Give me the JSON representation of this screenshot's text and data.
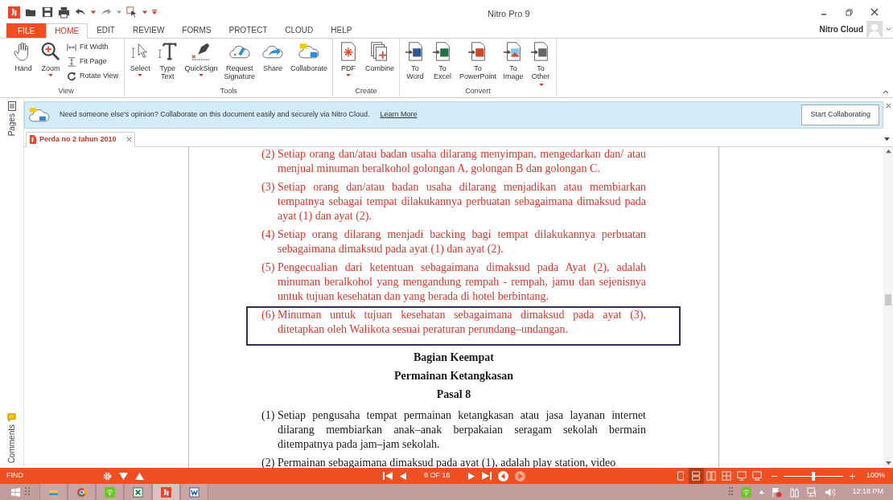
{
  "window": {
    "title": "Nitro Pro 9"
  },
  "ribbon_tabs": [
    {
      "label": "FILE",
      "kind": "file",
      "selected": false
    },
    {
      "label": "HOME",
      "kind": "tab",
      "selected": true
    },
    {
      "label": "EDIT",
      "kind": "tab",
      "selected": false
    },
    {
      "label": "REVIEW",
      "kind": "tab",
      "selected": false
    },
    {
      "label": "FORMS",
      "kind": "tab",
      "selected": false
    },
    {
      "label": "PROTECT",
      "kind": "tab",
      "selected": false
    },
    {
      "label": "CLOUD",
      "kind": "tab",
      "selected": false
    },
    {
      "label": "HELP",
      "kind": "tab",
      "selected": false
    }
  ],
  "account": {
    "label": "Nitro Cloud"
  },
  "ribbon_groups": [
    {
      "label": "View",
      "items": [
        {
          "kind": "large",
          "label": "Hand",
          "dropdown": false
        },
        {
          "kind": "large",
          "label": "Zoom",
          "dropdown": true
        },
        {
          "kind": "small",
          "label": "Fit Width"
        },
        {
          "kind": "small",
          "label": "Fit Page"
        },
        {
          "kind": "small",
          "label": "Rotate View"
        }
      ]
    },
    {
      "label": "Tools",
      "items": [
        {
          "kind": "large",
          "label": "Select",
          "dropdown": true
        },
        {
          "kind": "large",
          "label": "Type Text",
          "dropdown": false
        },
        {
          "kind": "large",
          "label": "QuickSign",
          "dropdown": true
        },
        {
          "kind": "large",
          "label": "Request Signature",
          "dropdown": false
        },
        {
          "kind": "large",
          "label": "Share",
          "dropdown": false
        },
        {
          "kind": "large",
          "label": "Collaborate",
          "dropdown": false
        }
      ]
    },
    {
      "label": "Create",
      "items": [
        {
          "kind": "large",
          "label": "PDF",
          "dropdown": true
        },
        {
          "kind": "large",
          "label": "Combine",
          "dropdown": false
        }
      ]
    },
    {
      "label": "Convert",
      "items": [
        {
          "kind": "large",
          "label": "To Word",
          "dropdown": false
        },
        {
          "kind": "large",
          "label": "To Excel",
          "dropdown": false
        },
        {
          "kind": "large",
          "label": "To PowerPoint",
          "dropdown": false
        },
        {
          "kind": "large",
          "label": "To Image",
          "dropdown": false
        },
        {
          "kind": "menu",
          "label": "To Other",
          "dropdown": true
        }
      ]
    }
  ],
  "side_panels": [
    {
      "label": "Pages"
    },
    {
      "label": "Comments"
    }
  ],
  "banner": {
    "message": "Need someone else's opinion? Collaborate on this document easily and securely via Nitro Cloud.",
    "link": "Learn More",
    "button": "Start Collaborating"
  },
  "doc_tabs": [
    {
      "label": "Perda no 2 tahun 2010",
      "selected": true
    }
  ],
  "document": {
    "blocks": [
      {
        "kind": "item",
        "number": "(2)",
        "text": "Setiap orang dan/atau badan usaha dilarang menyimpan, mengedarkan dan/ atau menjual minuman beralkohol golongan A, golongan B dan golongan C.",
        "color": "#e4332b",
        "boxed": false
      },
      {
        "kind": "item",
        "number": "(3)",
        "text": "Setiap orang dan/atau badan usaha dilarang menjadikan atau membiarkan tempatnya sebagai tempat dilakukannya perbuatan sebagaimana dimaksud pada ayat (1) dan ayat (2).",
        "color": "#e4332b",
        "boxed": false
      },
      {
        "kind": "item",
        "number": "(4)",
        "text": "Setiap orang dilarang menjadi backing bagi tempat dilakukannya perbuatan sebagaimana  dimaksud pada ayat (1) dan ayat (2).",
        "color": "#e4332b",
        "boxed": false
      },
      {
        "kind": "item",
        "number": "(5)",
        "text": "Pengecualian dari ketentuan sebagaimana dimaksud pada Ayat (2), adalah minuman beralkohol yang mengandung rempah - rempah, jamu dan sejenisnya untuk tujuan kesehatan dan yang berada di hotel berbintang.",
        "color": "#e4332b",
        "boxed": false
      },
      {
        "kind": "item",
        "number": "(6)",
        "text": "Minuman untuk tujuan kesehatan sebagaimana dimaksud pada ayat (3), ditetapkan oleh Walikota sesuai peraturan perundang–undangan.",
        "color": "#e4332b",
        "boxed": true
      },
      {
        "kind": "heading",
        "text": "Bagian Keempat"
      },
      {
        "kind": "heading",
        "text": "Permainan Ketangkasan"
      },
      {
        "kind": "heading",
        "text": "Pasal 8"
      },
      {
        "kind": "item",
        "number": "(1)",
        "text": "Setiap pengusaha tempat permainan ketangkasan atau jasa layanan internet dilarang membiarkan anak–anak berpakaian seragam sekolah bermain ditempatnya pada jam–jam sekolah.",
        "color": "#1a1a1a",
        "boxed": false
      },
      {
        "kind": "item",
        "number": "(2)",
        "text": "Permainan sebagaimana dimaksud pada ayat (1), adalah play station, video",
        "color": "#1a1a1a",
        "boxed": false
      }
    ]
  },
  "status_bar": {
    "find_label": "FIND",
    "page": "8 OF 16",
    "zoom": "100%",
    "zoom_slider": {
      "level": 0.5
    },
    "view_modes": [
      {
        "selected": false
      },
      {
        "selected": true
      },
      {
        "selected": false
      },
      {
        "selected": false
      },
      {
        "selected": false
      },
      {
        "selected": false
      }
    ]
  },
  "taskbar": {
    "apps": [
      {
        "selected": false
      },
      {
        "selected": false
      },
      {
        "selected": false
      },
      {
        "selected": false
      },
      {
        "selected": true
      },
      {
        "selected": false
      }
    ],
    "time": "12:18 PM"
  }
}
